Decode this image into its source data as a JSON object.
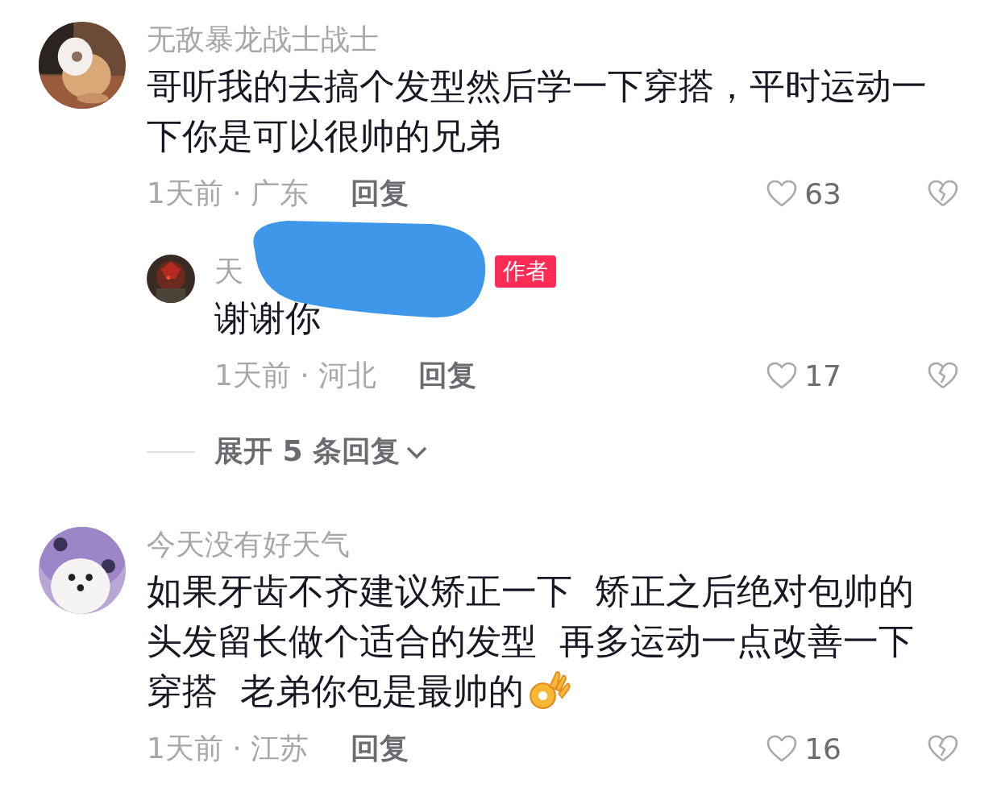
{
  "comments": [
    {
      "author": "无敌暴龙战士战士",
      "lines": [
        "哥听我的去搞个发型然后学一下穿搭，平时运动一",
        "下你是可以很帅的兄弟"
      ],
      "emoji": false,
      "meta": "1天前 · 广东",
      "reply_label": "回复",
      "likes": "63",
      "replies": [
        {
          "author": "天",
          "author_badge": "作者",
          "redacted": true,
          "lines": [
            "谢谢你"
          ],
          "meta": "1天前 · 河北",
          "reply_label": "回复",
          "likes": "17"
        }
      ],
      "expand_label": "展开 5 条回复"
    },
    {
      "author": "今天没有好天气",
      "lines": [
        "如果牙齿不齐建议矫正一下  矫正之后绝对包帅的",
        "头发留长做个适合的发型  再多运动一点改善一下",
        "穿搭  老弟你包是最帅的"
      ],
      "emoji": true,
      "meta": "1天前 · 江苏",
      "reply_label": "回复",
      "likes": "16"
    }
  ]
}
